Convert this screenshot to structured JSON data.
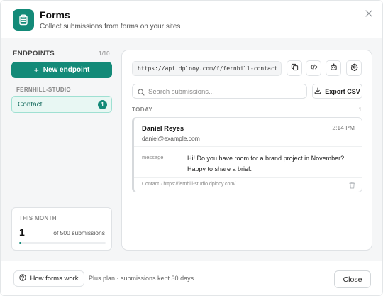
{
  "header": {
    "title": "Forms",
    "subtitle": "Collect submissions from forms on your sites",
    "app_icon": "clipboard-icon",
    "close_icon": "close-icon"
  },
  "sidebar": {
    "heading": "ENDPOINTS",
    "count": "1/10",
    "new_button": "New endpoint",
    "group_label": "FERNHILL-STUDIO",
    "endpoints": [
      {
        "label": "Contact",
        "badge": "1",
        "selected": true
      }
    ],
    "month": {
      "label": "THIS MONTH",
      "count": "1",
      "of_label": "of 500 submissions",
      "progress": 0.002
    }
  },
  "main": {
    "endpoint_url": "https://api.dplooy.com/f/fernhill-contact",
    "toolbar_icons": [
      "copy-icon",
      "code-icon",
      "bot-icon",
      "settings-icon"
    ],
    "search_placeholder": "Search submissions...",
    "export_label": "Export CSV",
    "group_heading": "TODAY",
    "group_count": "1",
    "submissions": [
      {
        "name": "Daniel Reyes",
        "email": "daniel@example.com",
        "time": "2:14 PM",
        "field_label": "message",
        "message": "Hi! Do you have room for a brand project in November? Happy to share a brief.",
        "source": "Contact · https://fernhill-studio.dplooy.com/"
      }
    ]
  },
  "footer": {
    "how_button": "How forms work",
    "plan_text": "Plus plan · submissions kept 30 days",
    "close_button": "Close"
  },
  "colors": {
    "accent": "#138a78",
    "accent_light": "#e8f7f3",
    "body_bg": "#f5f6f7"
  }
}
